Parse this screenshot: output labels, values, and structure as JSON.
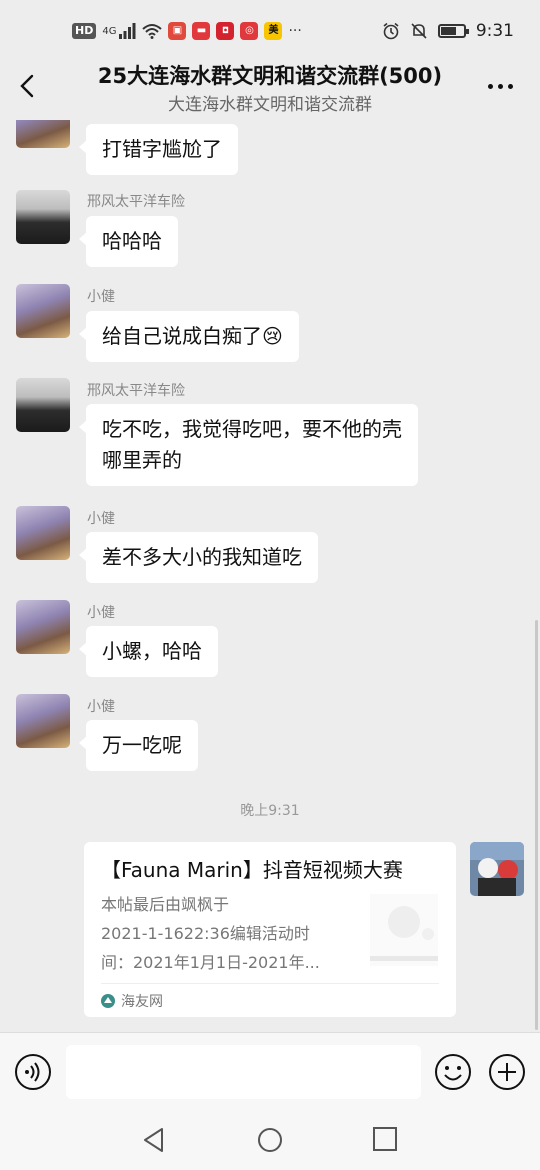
{
  "status_bar": {
    "hd_label": "HD",
    "network_label": "4G",
    "time": "9:31",
    "icons": [
      "signal-icon",
      "wifi-icon",
      "notification-app-icons",
      "alarm-icon",
      "mute-icon",
      "battery-icon"
    ],
    "battery_level_pct": 65,
    "app_badge_mei": "美",
    "overflow": "···"
  },
  "header": {
    "title": "25大连海水群文明和谐交流群(500)",
    "subtitle": "大连海水群文明和谐交流群"
  },
  "messages": [
    {
      "sender": "",
      "text": "打错字尴尬了",
      "avatar": "dog"
    },
    {
      "sender": "邢风太平洋车险",
      "text": "哈哈哈",
      "avatar": "man"
    },
    {
      "sender": "小健",
      "text": "给自己说成白痴了",
      "emoji": "😢",
      "avatar": "dog"
    },
    {
      "sender": "邢风太平洋车险",
      "text_line1": "吃不吃，我觉得吃吧，要不他的壳",
      "text_line2": "哪里弄的",
      "avatar": "man"
    },
    {
      "sender": "小健",
      "text": "差不多大小的我知道吃",
      "avatar": "dog"
    },
    {
      "sender": "小健",
      "text": "小螺，哈哈",
      "avatar": "dog"
    },
    {
      "sender": "小健",
      "text": "万一吃呢",
      "avatar": "dog"
    }
  ],
  "time_divider": "晚上9:31",
  "link_card": {
    "title": "【Fauna Marin】抖音短视频大赛",
    "desc_line1": "本帖最后由飒枫于",
    "desc_line2": "2021-1-1622:36编辑活动时",
    "desc_line3": "间：2021年1月1日-2021年...",
    "source": "海友网"
  },
  "input_bar": {
    "placeholder": ""
  },
  "colors": {
    "background": "#ededed",
    "bubble": "#ffffff",
    "secondary_text": "#888888"
  }
}
